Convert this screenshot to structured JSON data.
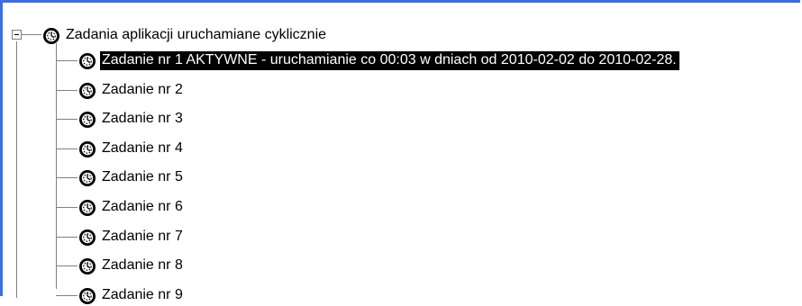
{
  "tree": {
    "root": {
      "label": "Zadania aplikacji uruchamiane cyklicznie",
      "icon": "clock-icon",
      "expanded": true
    },
    "items": [
      {
        "label": "Zadanie nr 1 AKTYWNE  - uruchamianie co 00:03  w dniach od 2010-02-02 do 2010-02-28.",
        "selected": true,
        "icon": "clock-icon"
      },
      {
        "label": "Zadanie nr 2",
        "selected": false,
        "icon": "clock-icon"
      },
      {
        "label": "Zadanie nr 3",
        "selected": false,
        "icon": "clock-icon"
      },
      {
        "label": "Zadanie nr 4",
        "selected": false,
        "icon": "clock-icon"
      },
      {
        "label": "Zadanie nr 5",
        "selected": false,
        "icon": "clock-icon"
      },
      {
        "label": "Zadanie nr 6",
        "selected": false,
        "icon": "clock-icon"
      },
      {
        "label": "Zadanie nr 7",
        "selected": false,
        "icon": "clock-icon"
      },
      {
        "label": "Zadanie nr 8",
        "selected": false,
        "icon": "clock-icon"
      },
      {
        "label": "Zadanie nr 9",
        "selected": false,
        "icon": "clock-icon"
      }
    ]
  },
  "colors": {
    "frame_border": "#3a6ee8",
    "selection_bg": "#000000",
    "selection_fg": "#ffffff",
    "tree_lines": "#808080"
  }
}
